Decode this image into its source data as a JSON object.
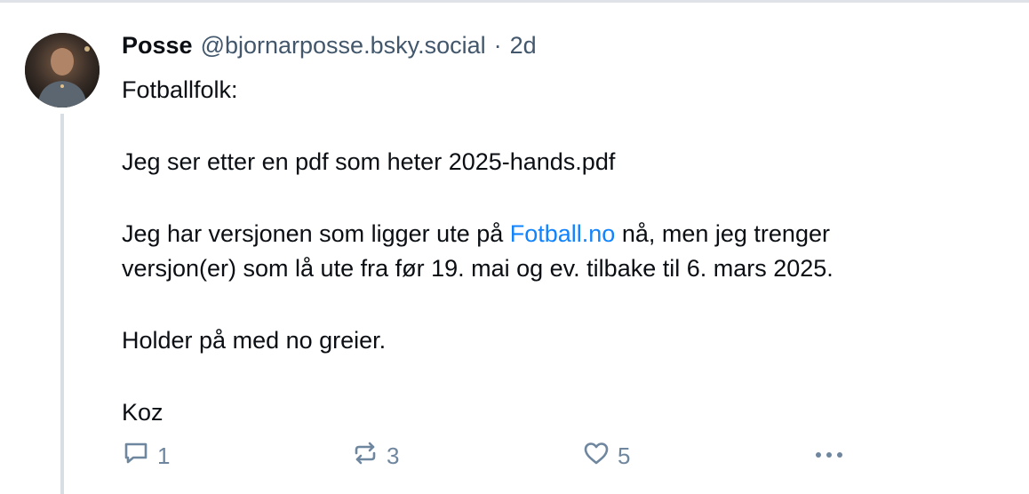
{
  "post": {
    "author": {
      "display_name": "Posse",
      "handle": "@bjornarposse.bsky.social",
      "separator": "·",
      "time_ago": "2d"
    },
    "content": {
      "line1": "Fotballfolk:",
      "line2": "Jeg ser etter en pdf som heter 2025-hands.pdf",
      "line3_before_link": "Jeg har versjonen som ligger ute på ",
      "line3_link": "Fotball.no",
      "line3_after_link": " nå, men jeg trenger",
      "line4": "versjon(er) som lå ute fra før 19. mai og ev. tilbake til 6. mars 2025.",
      "line5": "Holder på med no greier.",
      "line6": "Koz"
    },
    "actions": {
      "reply_count": "1",
      "repost_count": "3",
      "like_count": "5"
    }
  },
  "colors": {
    "link": "#1083fe",
    "muted": "#42576c",
    "action": "#6f869f",
    "thread_line": "#d9dee4"
  },
  "icons": {
    "reply": "reply-icon",
    "repost": "repost-icon",
    "like": "heart-icon",
    "more": "more-icon"
  }
}
